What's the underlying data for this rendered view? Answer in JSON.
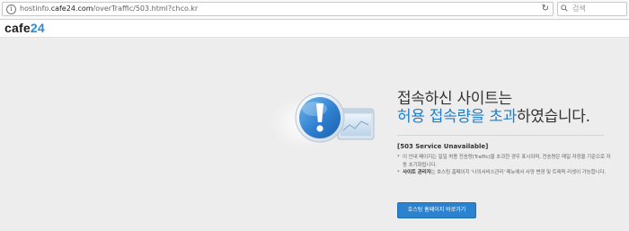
{
  "browser": {
    "url_prefix": "hostinfo.",
    "url_host": "cafe24.com",
    "url_suffix": "/overTraffic/503.html?chco.kr",
    "search_placeholder": "검색"
  },
  "header": {
    "logo_left": "cafe",
    "logo_right": "24"
  },
  "main": {
    "title_line1": "접속하신 사이트는",
    "title_line2_highlight": "허용 접속량을 초과",
    "title_line2_rest": "하였습니다.",
    "error_label": "[503 Service Unavailable]",
    "notes": [
      {
        "bullet": "*",
        "bold": "",
        "text": "이 안내 페이지는 일일 허용 전송량(Traffic)을 초과한 경우 표시되며, 전송량은 매일 자정을 기준으로 자동 초기화됩니다."
      },
      {
        "bullet": "*",
        "bold": "사이트 관리자",
        "text": "는 호스팅 홈페이지 '나의서비스관리' 메뉴에서 사양 변경 및 트래픽 리셋이 가능합니다."
      }
    ],
    "button_label": "호스팅 홈페이지 바로가기"
  },
  "colors": {
    "accent_blue": "#1f7ec8",
    "button_blue": "#2b82cf",
    "background": "#ededee"
  },
  "icons": [
    "info-icon",
    "reload-icon",
    "search-icon",
    "exclamation-icon",
    "monitor-icon"
  ]
}
